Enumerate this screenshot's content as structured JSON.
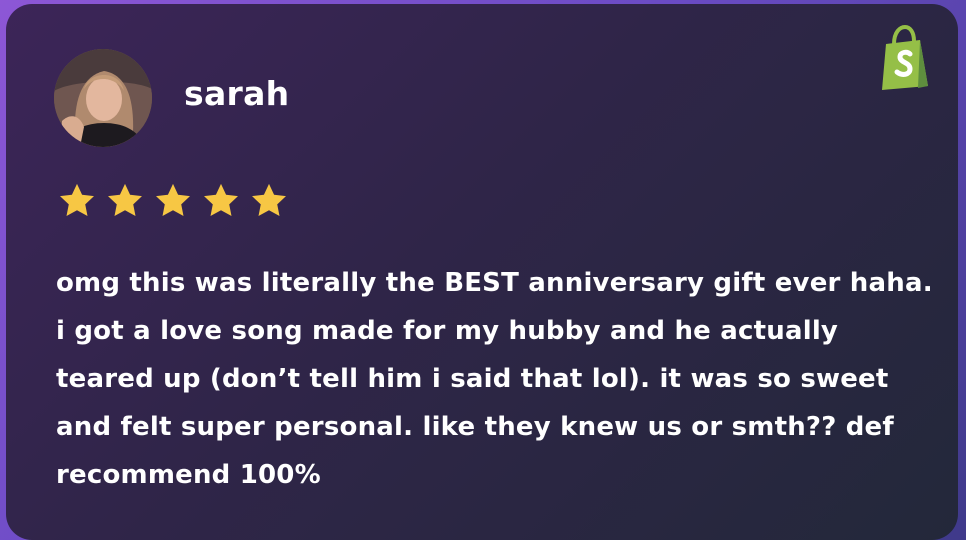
{
  "reviewer": {
    "name": "sarah",
    "avatar_icon": "user-photo"
  },
  "brand": {
    "icon": "shopify-bag-icon",
    "color": "#95bf47"
  },
  "rating": {
    "value": 5,
    "max": 5,
    "star_color": "#f7c744"
  },
  "review": {
    "text": "omg this was literally the BEST anniversary gift ever haha. i got a love song made for my hubby and he actually teared up (don’t tell him i said that lol). it was so sweet and felt super personal. like they knew us or smth?? def recommend 100%"
  }
}
